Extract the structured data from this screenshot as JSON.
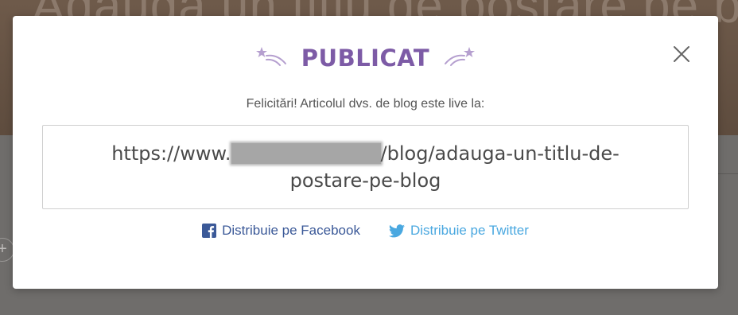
{
  "background": {
    "title_text": "Adauga un titlu de postare pe blog"
  },
  "modal": {
    "title": "PUBLICAT",
    "subtitle": "Felicitări! Articolul dvs. de blog este live la:",
    "url_prefix": "https://www.",
    "url_suffix": "/blog/adauga-un-titlu-de-postare-pe-blog",
    "share_facebook": "Distribuie pe Facebook",
    "share_twitter": "Distribuie pe Twitter"
  },
  "icons": {
    "close": "close-icon",
    "stars_left": "shooting-stars-icon",
    "stars_right": "shooting-stars-icon",
    "facebook": "facebook-icon",
    "twitter": "twitter-icon"
  },
  "colors": {
    "title": "#7d5ba6",
    "stars": "#b59fcf",
    "facebook": "#3b5998",
    "twitter": "#4aa8e0"
  }
}
